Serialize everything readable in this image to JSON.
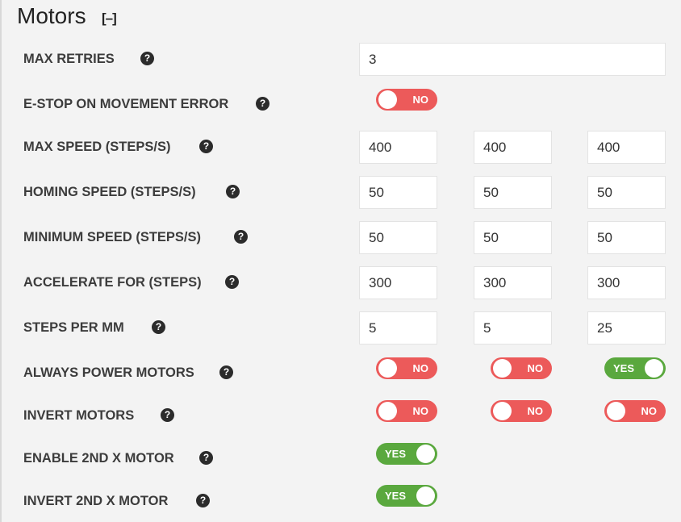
{
  "section": {
    "title": "Motors",
    "collapse": "[–]"
  },
  "rows": {
    "max_retries": {
      "label": "MAX RETRIES",
      "value": "3"
    },
    "estop": {
      "label": "E-STOP ON MOVEMENT ERROR",
      "toggle": "NO"
    },
    "max_speed": {
      "label": "MAX SPEED (STEPS/S)",
      "values": [
        "400",
        "400",
        "400"
      ]
    },
    "homing_speed": {
      "label": "HOMING SPEED (STEPS/S)",
      "values": [
        "50",
        "50",
        "50"
      ]
    },
    "min_speed": {
      "label": "MINIMUM SPEED (STEPS/S)",
      "values": [
        "50",
        "50",
        "50"
      ]
    },
    "accelerate": {
      "label": "ACCELERATE FOR (STEPS)",
      "values": [
        "300",
        "300",
        "300"
      ]
    },
    "steps_per_mm": {
      "label": "STEPS PER MM",
      "values": [
        "5",
        "5",
        "25"
      ]
    },
    "always_power": {
      "label": "ALWAYS POWER MOTORS",
      "toggles": [
        "NO",
        "NO",
        "YES"
      ]
    },
    "invert_motors": {
      "label": "INVERT MOTORS",
      "toggles": [
        "NO",
        "NO",
        "NO"
      ]
    },
    "enable_2nd_x": {
      "label": "ENABLE 2ND X MOTOR",
      "toggle": "YES"
    },
    "invert_2nd_x": {
      "label": "INVERT 2ND X MOTOR",
      "toggle": "YES"
    }
  },
  "help_glyph": "?",
  "icons": {
    "help": "question-circle-icon"
  },
  "colors": {
    "toggle_on": "#5aa83e",
    "toggle_off": "#ec5a5a",
    "help_icon": "#2b2b2b"
  }
}
